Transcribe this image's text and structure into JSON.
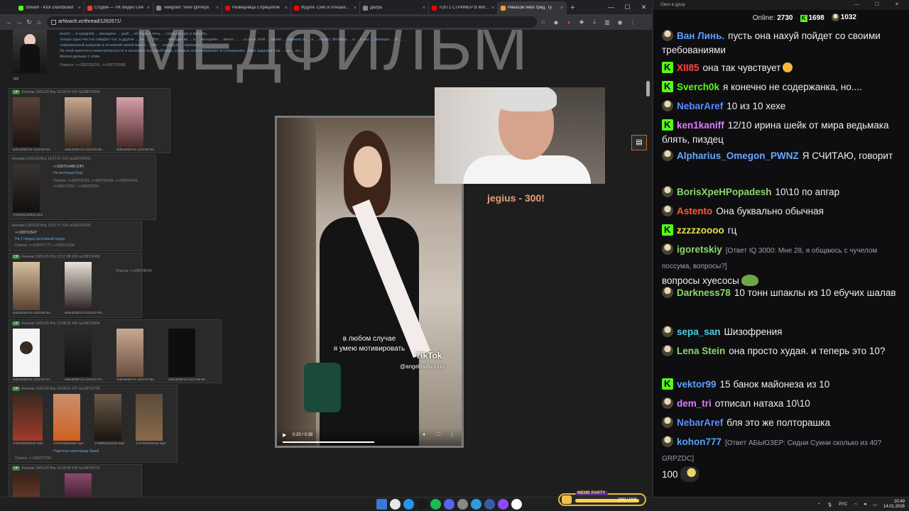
{
  "browser": {
    "tabs": [
      {
        "title": "Stream - Kick Dashboard",
        "color": "#53fc18"
      },
      {
        "title": "Студия — VK Видео Live",
        "color": "#ff3b30"
      },
      {
        "title": "Telegram: View @Petya",
        "color": "#888888"
      },
      {
        "title": "Разведчица с прицепом",
        "color": "#ff0000"
      },
      {
        "title": "Ждуля. Секс и отношения",
        "color": "#ff0000"
      },
      {
        "title": "Дw/pa",
        "color": "#888888"
      },
      {
        "title": "ТОП 1 СТРИМЕР В МИРЕ",
        "color": "#ff0000"
      },
      {
        "title": "Рикасов reels тред. Ту",
        "color": "#f0a030"
      }
    ],
    "new_tab": "+",
    "url": "arhivach.vc/thread/1292671/",
    "controls": {
      "minimize": "—",
      "maximize": "☐",
      "close": "✕"
    }
  },
  "overlay": {
    "title": "МЕДФИЛЬМ"
  },
  "thread": {
    "top_text": [
      "А не похуй, анон! Я вот вообще не предс... что будет особенно какое-то ... клубы с развлеканиями ... солей и ... на естественно ... наряженных человека ... а, когда ... пытаюсь дойти. То ... простой ... й этой женщине и большинство мужчин в современном мире ... , то есть вы не можете ... ... удой, прошлое очень ... много ... и средней ... женщине ... рый ... её будь о пять ... стать ресурс и вкусить,",
      "только одно честно говорит что, в другое ... не ... . Это ... ... женщин из ... и ... женщины ... много ... ... а эти в этой ... таком ... сорвала и ..., а ... на вас. Вообще ... и ... в нас ... женщин ... И ... ...",
      "современный девушки в основной своей массе ... это ... хорошую ... принцесс.",
      "Из этой низости и невоспитанности и вытекают все проблемы, которые они совершают в отношениях. Твоя задача в том ... не ... их с ...",
      "Жизни дальше с этим."
    ],
    "top_replies": "Ответы: >>328705226, >>328732085",
    "top_file": ".jpg",
    "posts": [
      {
        "header": "Аноним 13/01/26 Втр 13:55:07 #22 №328702564",
        "op": "OP",
        "files": [
          "video2026-01-1313-53-02...",
          "video2026-01-1313-53-08...",
          "video2026-01-1313-53-26..."
        ]
      },
      {
        "header": "Аноним 13/01/26 Втр 13:57:27 #23 №328702642",
        "lines": [
          ">>328701488 (OP)",
          "На вонтовый базу"
        ],
        "replies": "Ответы: >>328702751, >>328703336, >>328704744, >>328717097, >>328722591",
        "files": [
          "1766181126910.mp4"
        ]
      },
      {
        "header": "Аноним 13/01/26 Втр 13:57:27 #24 №328702649",
        "lines": [
          ">>328701547",
          "На 2 пиздец противный пидор."
        ],
        "replies": "Ответы: >>328707777, >>328711154"
      },
      {
        "header": "Аноним 13/01/26 Втр 13:57:38 #25 №328702658",
        "op": "OP",
        "replies": "Ответы: >>328708439",
        "files": [
          "video2026-01-1313-56-25...",
          "video2026-01-1313-57-09..."
        ]
      },
      {
        "header": "Аноним 13/01/26 Втр 13:58:25 #26 №328702694",
        "op": "OP",
        "files": [
          "video2026-01-1313-57-37...",
          "video2026-01-1313-57-47...",
          "video2026-01-1313-57-55...",
          "video2026-01-1113-58-08..."
        ]
      },
      {
        "header": "Аноним 13/01/26 Втр 13:58:42 #27 №328702700",
        "op": "OP",
        "lines": [
          "Подлятка говнотреда базой"
        ],
        "replies": "Ответы: >>328707759",
        "files": [
          "1750109529452.mp4",
          "1750109521884.mp4",
          "1748864541042.mp4",
          "1747684105163.mp4"
        ]
      },
      {
        "header": "Аноним 13/01/26 Втр 13:58:58 #28 №328702737",
        "op": "OP"
      }
    ]
  },
  "video": {
    "caption_line1": "в любом случае",
    "caption_line2": "я умею мотивировать",
    "tiktok_logo": "TikTok",
    "tiktok_handle": "@angelinafuuuuu",
    "time": "0:20 / 0:38",
    "progress": 0.53
  },
  "donation": {
    "text": "jegius - 300!"
  },
  "chat": {
    "window_title": "Окно в душу",
    "online_label": "Online:",
    "online_count": "2730",
    "kick_count": "1698",
    "other_count": "1032",
    "messages": [
      {
        "badge": "face",
        "user": "Ван Линь.",
        "color": "#5aa0ff",
        "text": "пусть она нахуй пойдет со своими требованиями"
      },
      {
        "badge": "kick",
        "user": "XII85",
        "color": "#ff4545",
        "text": "она так чувствует",
        "emote": "laugh"
      },
      {
        "badge": "kick",
        "user": "Sverch0k",
        "color": "#53fc18",
        "text": "я конечно не содержанка, но...."
      },
      {
        "badge": "face",
        "user": "NebarAref",
        "color": "#5a8cff",
        "text": "10 из 10 хехе"
      },
      {
        "badge": "kick",
        "user": "ken1kaniff",
        "color": "#e07cff",
        "text": "12/10 ирина шейк от мира ведьмака блять, пиздец"
      },
      {
        "badge": "face",
        "user": "Alpharius_Omegon_PWNZ",
        "color": "#6aa6ff",
        "text": "Я СЧИТАЮ, говорит"
      },
      {
        "badge": "face",
        "user": "BorisXpeHPopadesh",
        "color": "#8ad86a",
        "text": "10\\10 по апгар"
      },
      {
        "badge": "face",
        "user": "Astento",
        "color": "#ff5a3c",
        "text": "Она буквально обычная"
      },
      {
        "badge": "kick",
        "user": "zzzzzoooo",
        "color": "#e8e04a",
        "text": "гц"
      },
      {
        "badge": "face",
        "user": "igoretskiy",
        "color": "#8ad86a",
        "reply": "[Ответ IQ 3000: Мне 28, я общаюсь с чучелом поссума, вопросы?]",
        "text": "вопросы хуесосы",
        "emote": "frog"
      },
      {
        "badge": "face",
        "user": "Darkness78",
        "color": "#8ad86a",
        "text": "10 тонн шпаклы из 10 ебучих шалав"
      },
      {
        "badge": "face",
        "user": "sepa_san",
        "color": "#4ad0e0",
        "text": "Шизофрения"
      },
      {
        "badge": "face",
        "user": "Lena Stein",
        "color": "#8ad86a",
        "text": "она просто худая. и теперь это 10?"
      },
      {
        "badge": "kick",
        "user": "vektor99",
        "color": "#5aa0ff",
        "text": "15 банок майонеза из 10"
      },
      {
        "badge": "face",
        "user": "dem_tri",
        "color": "#e07cff",
        "text": "отписал натаха 10\\10"
      },
      {
        "badge": "face",
        "user": "NebarAref",
        "color": "#5a8cff",
        "text": "бля это же полторашка"
      },
      {
        "badge": "face",
        "user": "kohon777",
        "color": "#5aa0ff",
        "reply": "[Ответ АБЬЮЗЕР: Сидни Суини сколько из 40? GRPZDC]",
        "text": "100",
        "emote": "pepe"
      }
    ]
  },
  "meme_party": {
    "label": "MEME PARTY",
    "count": "1500 / 1500",
    "progress": 1.0
  },
  "taskbar": {
    "lang": "РУС",
    "time": "20:49",
    "date": "14.01.2026",
    "apps": [
      "#3a78d8",
      "#e8e8e8",
      "#2196f3",
      "#1a1a1a",
      "#1db954",
      "#5865f2",
      "#888888",
      "#2d9cdb",
      "#3a5aa8",
      "#9146ff",
      "#ffffff"
    ]
  }
}
